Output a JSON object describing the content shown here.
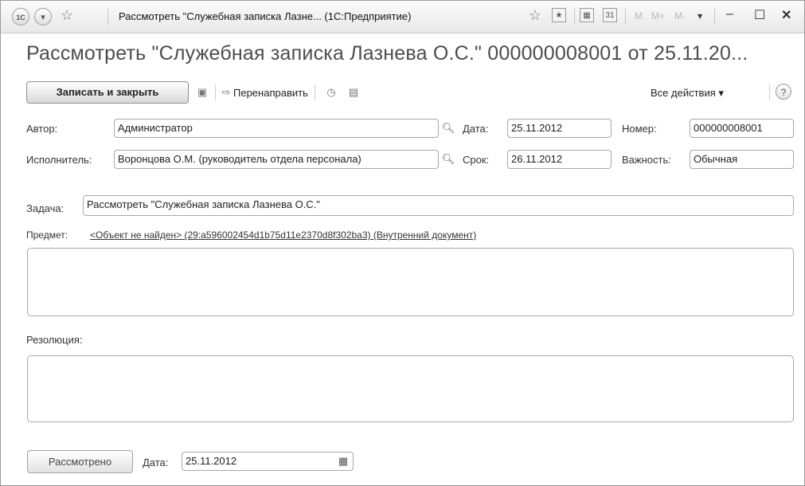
{
  "window": {
    "title": "Рассмотреть \"Служебная записка  Лазне... (1С:Предприятие)",
    "logo_text": "1С",
    "memory_labels": [
      "M",
      "M+",
      "M-"
    ]
  },
  "form": {
    "heading": "Рассмотреть \"Служебная записка  Лазнева О.С.\" 000000008001 от 25.11.20..."
  },
  "toolbar": {
    "save_close_label": "Записать и закрыть",
    "forward_label": "Перенаправить",
    "all_actions_label": "Все действия",
    "help_label": "?"
  },
  "fields": {
    "author_label": "Автор:",
    "author_value": "Администратор",
    "date_label": "Дата:",
    "date_value": "25.11.2012",
    "number_label": "Номер:",
    "number_value": "000000008001",
    "executor_label": "Исполнитель:",
    "executor_value": "Воронцова О.М. (руководитель отдела персонала)",
    "deadline_label": "Срок:",
    "deadline_value": "26.11.2012",
    "importance_label": "Важность:",
    "importance_value": "Обычная",
    "task_label": "Задача:",
    "task_value": "Рассмотреть \"Служебная записка  Лазнева О.С.\"",
    "subject_label": "Предмет:",
    "subject_link": "<Объект не найден> (29:a596002454d1b75d11e2370d8f302ba3) (Внутренний документ)",
    "resolution_label": "Резолюция:"
  },
  "footer": {
    "reviewed_label": "Рассмотрено",
    "date_label": "Дата:",
    "date_value": "25.11.2012"
  }
}
